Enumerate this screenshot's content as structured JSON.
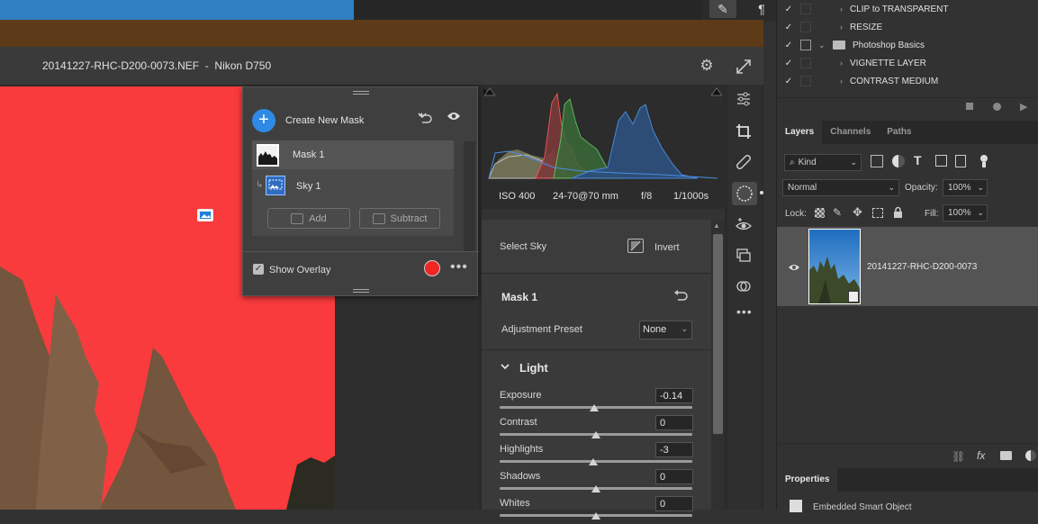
{
  "acr": {
    "title": "20141227-RHC-D200-0073.NEF  -  Nikon D750"
  },
  "mask_panel": {
    "create_label": "Create New Mask",
    "mask_name": "Mask 1",
    "component_name": "Sky 1",
    "add_label": "Add",
    "subtract_label": "Subtract",
    "overlay_label": "Show Overlay",
    "overlay_checked": true,
    "overlay_color": "#f22525"
  },
  "exif": {
    "iso": "ISO 400",
    "lens": "24-70@70 mm",
    "aperture": "f/8",
    "shutter": "1/1000s"
  },
  "right_panel": {
    "component_label": "Select Sky",
    "invert_label": "Invert",
    "mask_title": "Mask 1",
    "preset_label": "Adjustment Preset",
    "preset_value": "None",
    "section_title": "Light",
    "sliders": [
      {
        "label": "Exposure",
        "value": "-0.14",
        "pos": 0.49
      },
      {
        "label": "Contrast",
        "value": "0",
        "pos": 0.5
      },
      {
        "label": "Highlights",
        "value": "-3",
        "pos": 0.485
      },
      {
        "label": "Shadows",
        "value": "0",
        "pos": 0.5
      },
      {
        "label": "Whites",
        "value": "0",
        "pos": 0.5
      }
    ]
  },
  "actions": [
    {
      "label": "CLIP to TRANSPARENT",
      "folder": false
    },
    {
      "label": "RESIZE",
      "folder": false
    },
    {
      "label": "Photoshop Basics",
      "folder": true
    },
    {
      "label": "VIGNETTE LAYER",
      "folder": false
    },
    {
      "label": "CONTRAST MEDIUM",
      "folder": false
    }
  ],
  "layers": {
    "tabs": [
      "Layers",
      "Channels",
      "Paths"
    ],
    "kind_label": "Kind",
    "blend_mode": "Normal",
    "opacity_label": "Opacity:",
    "opacity_value": "100%",
    "lock_label": "Lock:",
    "fill_label": "Fill:",
    "fill_value": "100%",
    "layer_name": "20141227-RHC-D200-0073"
  },
  "properties": {
    "tab": "Properties",
    "subtitle": "Embedded Smart Object"
  }
}
